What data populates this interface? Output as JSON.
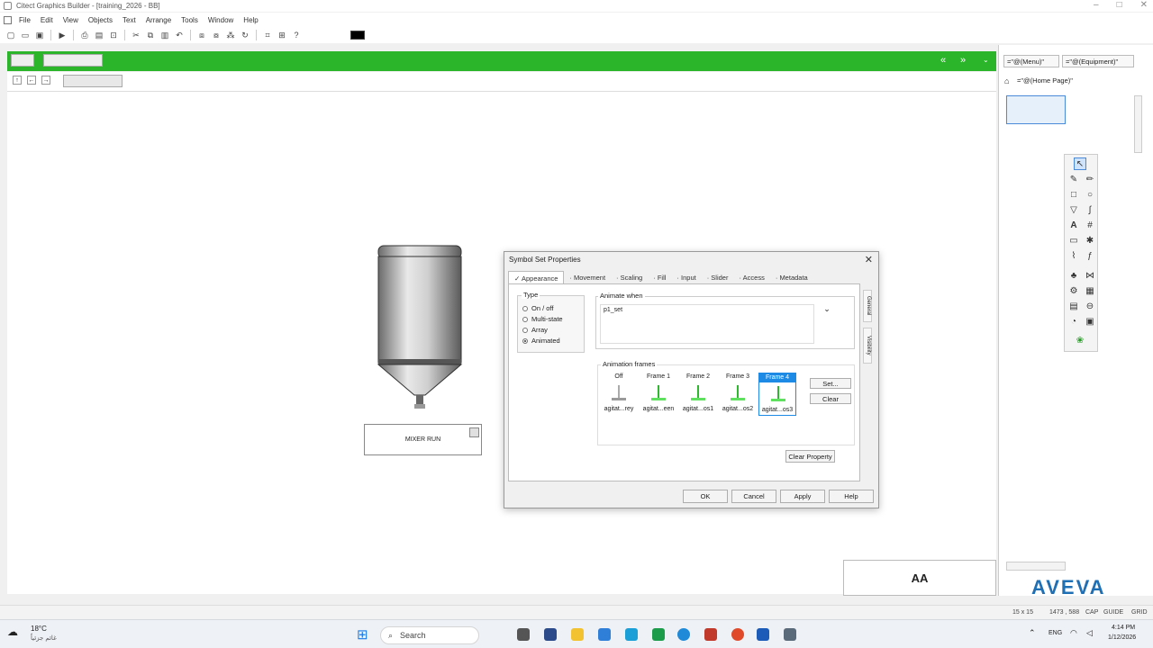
{
  "window": {
    "title": "Citect Graphics Builder - [training_2026 - BB]"
  },
  "menu": [
    "File",
    "Edit",
    "View",
    "Objects",
    "Text",
    "Arrange",
    "Tools",
    "Window",
    "Help"
  ],
  "toolbar": {
    "help_label": "?"
  },
  "canvas": {
    "mixer_button_label": "MIXER RUN",
    "aa_label": "AA"
  },
  "dialog": {
    "title": "Symbol Set Properties",
    "tabs": [
      "Appearance",
      "Movement",
      "Scaling",
      "Fill",
      "Input",
      "Slider",
      "Access",
      "Metadata"
    ],
    "active_tab": "Appearance",
    "type_legend": "Type",
    "type_options": [
      "On / off",
      "Multi-state",
      "Array",
      "Animated"
    ],
    "selected_type": "Animated",
    "animate_when_legend": "Animate when",
    "animate_expression": "p1_set",
    "side_tabs": [
      "General",
      "Visibility"
    ],
    "frames_legend": "Animation frames",
    "frames": [
      {
        "header": "Off",
        "label": "agitat...rey"
      },
      {
        "header": "Frame 1",
        "label": "agitat...een"
      },
      {
        "header": "Frame 2",
        "label": "agitat...os1"
      },
      {
        "header": "Frame 3",
        "label": "agitat...os2"
      },
      {
        "header": "Frame 4",
        "label": "agitat...os3"
      }
    ],
    "selected_frame": "Frame 4",
    "set_label": "Set...",
    "clear_label": "Clear",
    "clear_property_label": "Clear Property",
    "ok_label": "OK",
    "cancel_label": "Cancel",
    "apply_label": "Apply",
    "help_label": "Help"
  },
  "right_panel": {
    "menu_field": "=\"@(Menu)\"",
    "equipment_field": "=\"@(Equipment)\"",
    "home_field": "=\"@(Home Page)\"",
    "brand": "AVEVA"
  },
  "statusbar": {
    "grid_size": "15 x 15",
    "coords": "1473 , 588",
    "cap": "CAP",
    "guide": "GUIDE",
    "grid": "GRID"
  },
  "taskbar": {
    "weather_temp": "18°C",
    "weather_desc": "غائم جزئياً",
    "search_label": "Search",
    "lang": "ENG",
    "time": "4:14 PM",
    "date": "1/12/2026"
  }
}
